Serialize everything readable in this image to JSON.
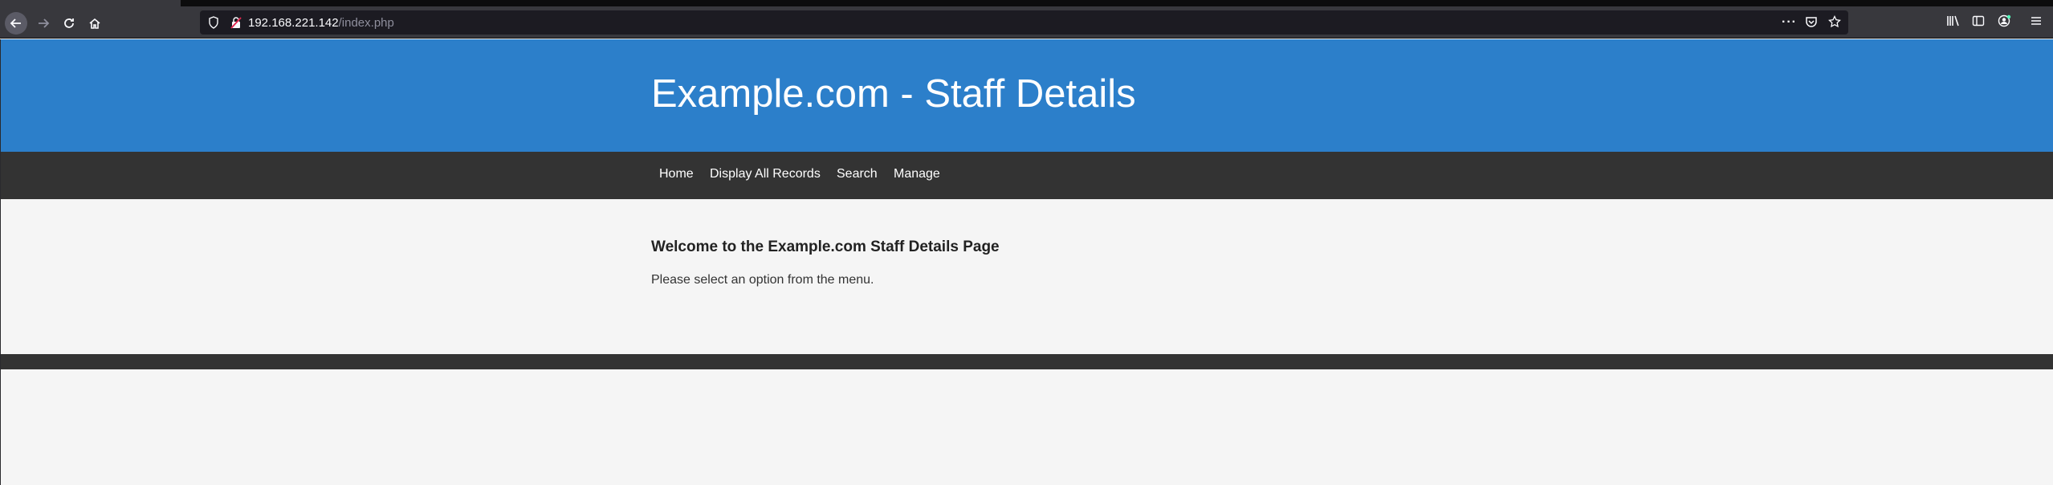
{
  "browser": {
    "url_host": "192.168.221.142",
    "url_path": "/index.php",
    "icons": [
      "back-icon",
      "forward-icon",
      "reload-icon",
      "home-icon",
      "shield-icon",
      "insecure-lock-icon",
      "more-icon",
      "pocket-icon",
      "star-icon",
      "library-icon",
      "sidebar-icon",
      "account-icon",
      "menu-icon"
    ]
  },
  "header": {
    "title": "Example.com - Staff Details"
  },
  "nav": {
    "items": [
      "Home",
      "Display All Records",
      "Search",
      "Manage"
    ]
  },
  "main": {
    "heading": "Welcome to the Example.com Staff Details Page",
    "text": "Please select an option from the menu."
  },
  "colors": {
    "header_bg": "#2c7fca",
    "nav_bg": "#333333",
    "page_bg": "#f5f5f5"
  }
}
